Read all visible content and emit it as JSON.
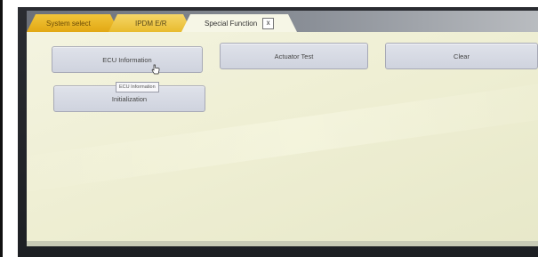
{
  "tabs": [
    {
      "label": "System select"
    },
    {
      "label": "IPDM E/R"
    },
    {
      "label": "Special Function",
      "close": "x"
    }
  ],
  "buttons": {
    "ecu_information": "ECU Information",
    "actuator_test": "Actuator Test",
    "clear": "Clear",
    "initialization": "Initialization"
  },
  "tooltip": "ECU Information",
  "colors": {
    "active_tab": "#f6f6e6",
    "inactive_tab": "#e8b420",
    "button": "#d6d9e3",
    "screen_bg": "#efefd4"
  }
}
